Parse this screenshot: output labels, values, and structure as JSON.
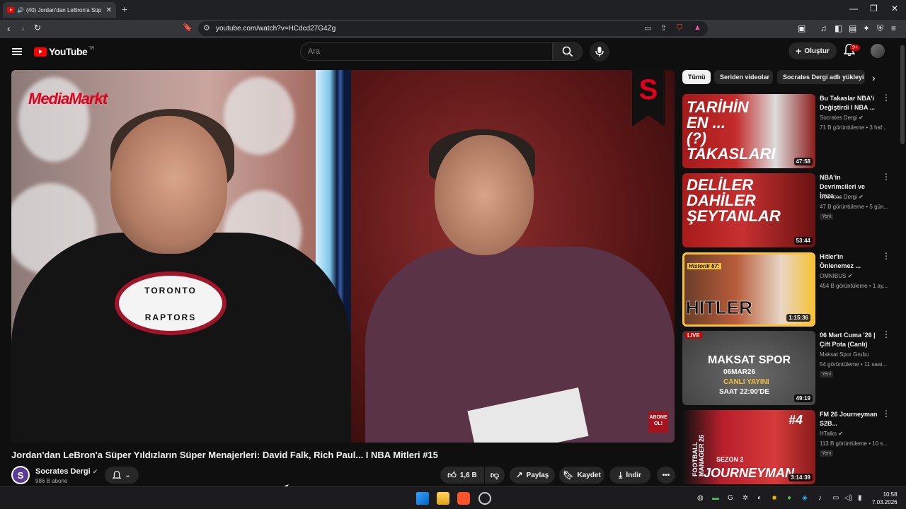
{
  "browser": {
    "tab_title": "(40) Jordan'dan LeBron'a Süp",
    "url": "youtube.com/watch?v=HCdcd27G4Zg"
  },
  "masthead": {
    "logo_text": "YouTube",
    "country_code": "TR",
    "search_placeholder": "Ara",
    "create_label": "Oluştur",
    "notification_badge": "9+"
  },
  "video": {
    "sponsor_logo": "MediaMarkt",
    "channel_logo_letter": "S",
    "subscribe_overlay": "ABONE OL!",
    "jersey_text_top": "TORONTO",
    "jersey_text_bottom": "RAPTORS",
    "title": "Jordan'dan LeBron'a Süper Yıldızların Süper Menajerleri: David Falk, Rich Paul... I NBA Mitleri #15"
  },
  "channel": {
    "avatar_letter": "S",
    "name": "Socrates Dergi",
    "subscribers": "986 B abone"
  },
  "actions": {
    "likes": "1,6 B",
    "share": "Paylaş",
    "save": "Kaydet",
    "download": "İndir"
  },
  "chips": [
    "Tümü",
    "Seriden videolar",
    "Socrates Dergi adlı yükleyi"
  ],
  "recommendations": [
    {
      "title": "Bu Takaslar NBA'i Değiştirdi I NBA ...",
      "channel": "Socrates Dergi",
      "meta": "71 B görüntüleme • 3 haf...",
      "duration": "47:58",
      "thumb_text": "TARİHİN EN ... (?) TAKASLARI",
      "is_new": "",
      "verified": true
    },
    {
      "title": "NBA'in Devrimcileri ve İmza ...",
      "channel": "Socrates Dergi",
      "meta": "47 B görüntüleme • 5 gün...",
      "duration": "53:44",
      "thumb_text": "DELİLER DAHİLER ŞEYTANLAR",
      "is_new": "Yeni",
      "verified": true
    },
    {
      "title": "Hitler'in Önlenemez ...",
      "channel": "OMNIBUS",
      "meta": "454 B görüntüleme • 1 ay...",
      "duration": "1:15:36",
      "thumb_text": "HITLER",
      "thumb_tag": "Historik 67:",
      "is_new": "",
      "verified": true
    },
    {
      "title": "06 Mart Cuma '26 | Çift Pota (Canlı)",
      "channel": "Maksat Spor Grubu",
      "meta": "54 görüntüleme • 11 saat...",
      "duration": "49:19",
      "thumb_text": "MAKSAT SPOR",
      "thumb_tag": "LIVE",
      "thumb_sub1": "06MAR26",
      "thumb_sub2": "CANLI YAYINI",
      "thumb_sub3": "SAAT 22:00'DE",
      "is_new": "Yeni",
      "verified": false
    },
    {
      "title": "FM 26 Journeyman S2B...",
      "channel": "HTalks",
      "meta": "113 B görüntüleme • 10 s...",
      "duration": "3:14:39",
      "thumb_text": "JOURNEYMAN",
      "thumb_tag": "#4",
      "thumb_sub1": "SEZON 2",
      "thumb_sub2": "FOOTBALL MANAGER 26",
      "is_new": "Yeni",
      "verified": true
    }
  ],
  "taskbar": {
    "time": "10:58",
    "date": "7.03.2026"
  },
  "colors": {
    "accent": "#ff0000",
    "background": "#0f0f0f",
    "mediamarkt_red": "#e2001a"
  }
}
